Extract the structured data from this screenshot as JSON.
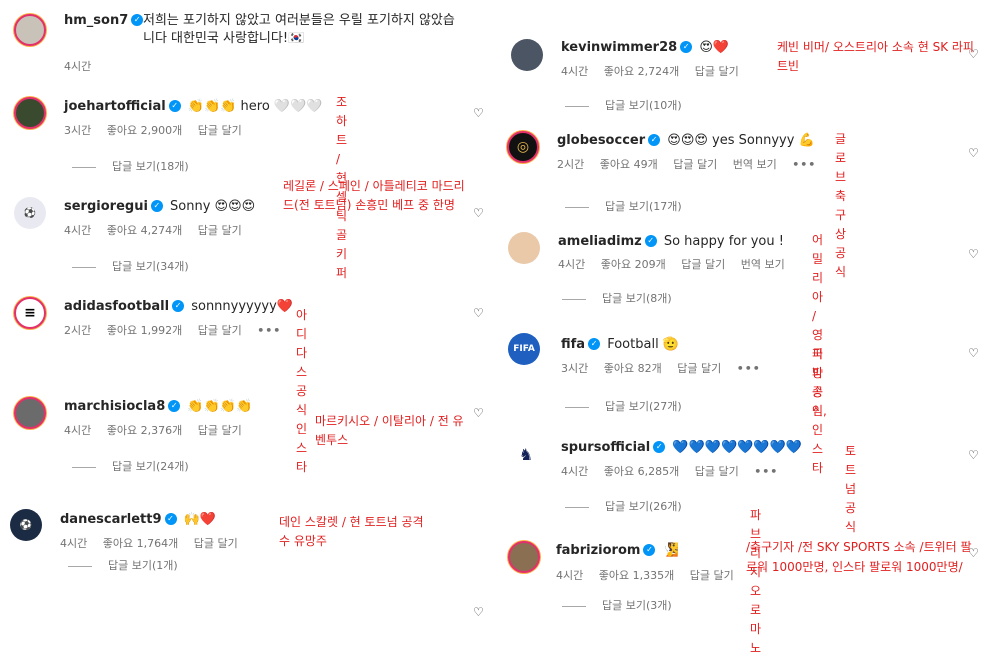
{
  "comments_left": [
    {
      "username": "hm_son7",
      "text": "저희는 포기하지 않았고 여러분들은 우릴 포기하지 않았습니다 대한민국 사랑합니다!🇰🇷",
      "time": "4시간"
    },
    {
      "username": "joehartofficial",
      "text": "👏👏👏 hero 🤍🤍🤍",
      "time": "3시간",
      "likes": "좋아요 2,900개",
      "reply": "답글 달기",
      "replies": "답글 보기(18개)",
      "note": "조 하트 / 현 셀틱 골키퍼"
    },
    {
      "username": "sergioregui",
      "text": "Sonny 😍😍😍",
      "time": "4시간",
      "likes": "좋아요 4,274개",
      "reply": "답글 달기",
      "replies": "답글 보기(34개)",
      "note": "레길론 / 스페인 / 아틀레티코 마드리드(전 토트넘) 손흥민 베프 중 한명"
    },
    {
      "username": "adidasfootball",
      "text": "sonnnyyyyyy❤️",
      "time": "2시간",
      "likes": "좋아요 1,992개",
      "reply": "답글 달기",
      "more": "•••",
      "note": "아디다스 공식 인스타"
    },
    {
      "username": "marchisiocla8",
      "text": "👏👏👏👏",
      "time": "4시간",
      "likes": "좋아요 2,376개",
      "reply": "답글 달기",
      "replies": "답글 보기(24개)",
      "note": "마르키시오 / 이탈리아 / 전 유벤투스"
    },
    {
      "username": "danescarlett9",
      "text": "🙌❤️",
      "time": "4시간",
      "likes": "좋아요 1,764개",
      "reply": "답글 달기",
      "replies": "답글 보기(1개)",
      "note": "데인 스칼렛 / 현 토트넘 공격수 유망주"
    }
  ],
  "comments_right": [
    {
      "username": "kevinwimmer28",
      "text": "😍❤️",
      "time": "4시간",
      "likes": "좋아요 2,724개",
      "reply": "답글 달기",
      "replies": "답글 보기(10개)",
      "note": "케빈 비머/ 오스트리아 소속 현 SK 라피트빈"
    },
    {
      "username": "globesoccer",
      "text": "😍😍😍 yes Sonnyyy 💪",
      "time": "2시간",
      "likes": "좋아요 49개",
      "reply": "답글 달기",
      "translate": "번역 보기",
      "more": "•••",
      "replies": "답글 보기(17개)",
      "note": "글로브 축구상 공식"
    },
    {
      "username": "ameliadimz",
      "text": "So happy for you !",
      "time": "4시간",
      "likes": "좋아요 209개",
      "reply": "답글 달기",
      "translate": "번역 보기",
      "replies": "답글 보기(8개)",
      "note": "어밀리아 / 영국 방송인,"
    },
    {
      "username": "fifa",
      "text": "Football 🫡",
      "time": "3시간",
      "likes": "좋아요 82개",
      "reply": "답글 달기",
      "more": "•••",
      "replies": "답글 보기(27개)",
      "note": "피파 공식 인스타"
    },
    {
      "username": "spursofficial",
      "text": "💙💙💙💙💙💙💙💙",
      "time": "4시간",
      "likes": "좋아요 6,285개",
      "reply": "답글 달기",
      "more": "•••",
      "replies": "답글 보기(26개)",
      "note": "토트넘 공식"
    },
    {
      "username": "fabriziorom",
      "text": "🧏",
      "time": "4시간",
      "likes": "좋아요 1,335개",
      "reply": "답글 달기",
      "replies": "답글 보기(3개)",
      "note_title": "파브리지오 로마노",
      "note": "/축구기자 /전 SKY SPORTS 소속 /트위터 팔로워 1000만명, 인스타 팔로워 1000만명/"
    }
  ],
  "colors": {
    "annotation": "#e02020",
    "verified": "#0095f6",
    "meta": "#737373"
  },
  "icons": {
    "verified": "verified-badge-icon",
    "like": "heart-outline-icon"
  }
}
